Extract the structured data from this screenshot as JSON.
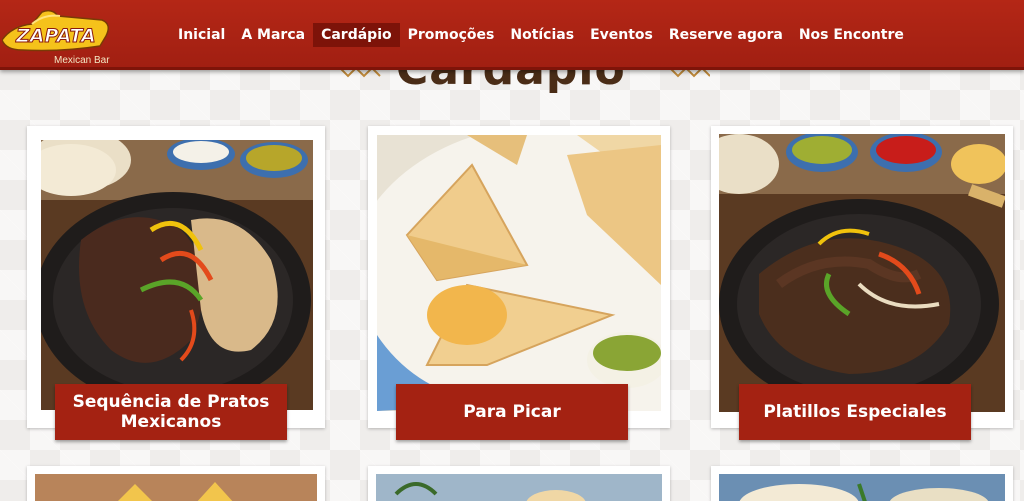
{
  "brand": {
    "name": "ZAPATA",
    "subtitle": "Mexican Bar"
  },
  "nav": {
    "items": [
      {
        "label": "Inicial"
      },
      {
        "label": "A Marca"
      },
      {
        "label": "Cardápio",
        "active": true
      },
      {
        "label": "Promoções"
      },
      {
        "label": "Notícias"
      },
      {
        "label": "Eventos"
      },
      {
        "label": "Reserve agora"
      },
      {
        "label": "Nos Encontre"
      }
    ]
  },
  "page": {
    "title": "Cardápio"
  },
  "menu_categories": [
    {
      "label": "Sequência de Pratos Mexicanos",
      "icon": "fajitas-photo"
    },
    {
      "label": "Para Picar",
      "icon": "pastel-photo"
    },
    {
      "label": "Platillos Especiales",
      "icon": "steak-skillet-photo"
    }
  ],
  "colors": {
    "header_red": "#a11f12",
    "active_nav": "#7d1309",
    "label_red": "#a42212",
    "title_brown": "#4a2c16",
    "logo_yellow": "#f5c21b"
  }
}
